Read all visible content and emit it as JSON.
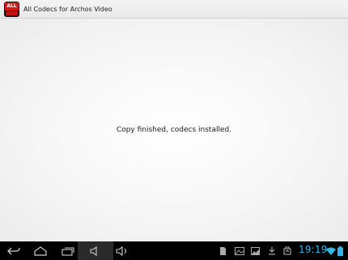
{
  "app": {
    "title": "All Codecs for Archos Video",
    "icon_name": "all-codecs-app-icon",
    "icon_text": "ALL"
  },
  "main": {
    "message": "Copy finished, codecs installed."
  },
  "navbar": {
    "buttons": [
      "back-icon",
      "home-icon",
      "recent-apps-icon",
      "volume-down-icon",
      "volume-up-icon"
    ]
  },
  "status": {
    "icons": [
      "sd-card-icon",
      "gallery-icon",
      "picture-icon",
      "download-icon",
      "usb-debug-icon",
      "wifi-icon",
      "battery-icon"
    ],
    "time": "19:19",
    "accent": "#33b5e5"
  }
}
